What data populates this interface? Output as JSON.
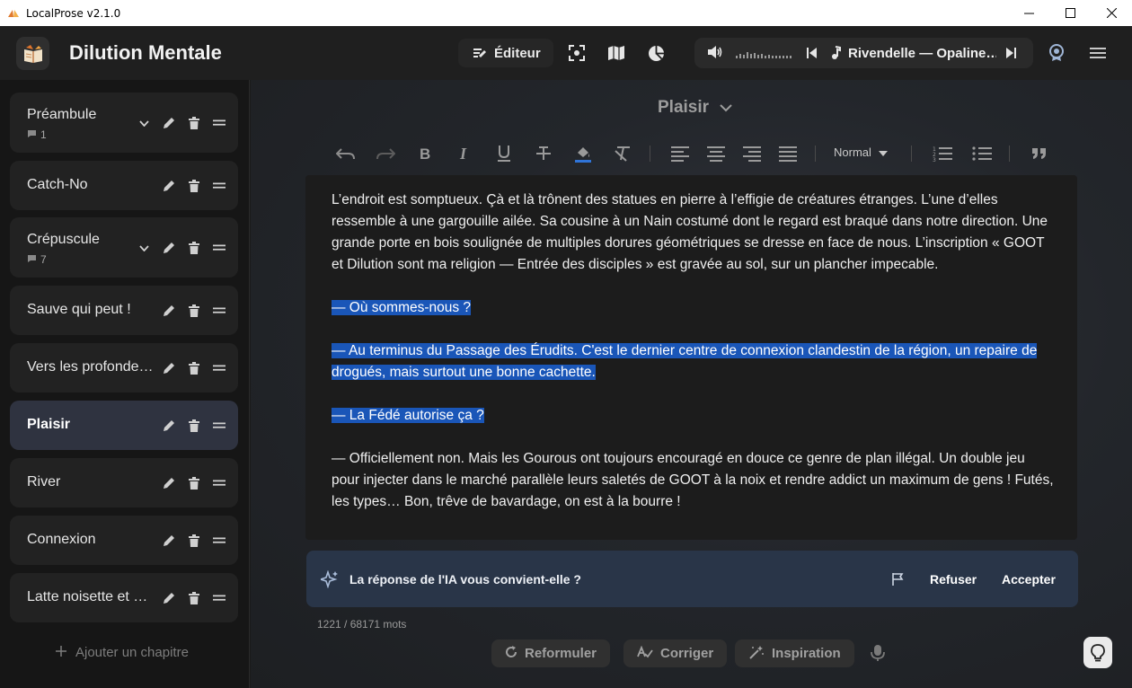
{
  "window": {
    "title": "LocalProse v2.1.0"
  },
  "header": {
    "doc_title": "Dilution Mentale",
    "editor_label": "Éditeur",
    "track": "Rivendelle — Opaline…"
  },
  "chapters": [
    {
      "title": "Préambule",
      "comments": "1",
      "expandable": true
    },
    {
      "title": "Catch-No"
    },
    {
      "title": "Crépuscule",
      "comments": "7",
      "expandable": true
    },
    {
      "title": "Sauve qui peut !"
    },
    {
      "title": "Vers les profonde…"
    },
    {
      "title": "Plaisir",
      "active": true
    },
    {
      "title": "River"
    },
    {
      "title": "Connexion"
    },
    {
      "title": "Latte noisette et …"
    }
  ],
  "sidebar": {
    "add_label": "Ajouter un chapitre"
  },
  "editor": {
    "chapter_selected": "Plaisir",
    "style_value": "Normal",
    "paragraphs": [
      "L’endroit est somptueux. Çà et là trônent des statues en pierre à l’effigie de créatures étranges. L’une d’elles ressemble à une gargouille ailée. Sa cousine à un Nain costumé dont le regard est braqué dans notre direction. Une grande porte en bois soulignée de multiples dorures géométriques se dresse en face de nous. L’inscription « GOOT et Dilution sont ma religion — Entrée des disciples » est gravée au sol, sur un plancher impecable.",
      "— Où sommes-nous ?",
      "— Au terminus du Passage des Érudits. C'est le dernier centre de connexion clandestin de la région, un repaire de drogués, mais surtout une bonne cachette.",
      "— La Fédé autorise ça ?",
      "— Officiellement non. Mais les Gourous ont toujours encouragé en douce ce genre de plan illégal. Un double jeu pour injecter dans le marché parallèle leurs saletés de GOOT à la noix et rendre addict un maximum de gens ! Futés, les types… Bon, trêve de bavardage, on est à la bourre !"
    ]
  },
  "ai_bar": {
    "question": "La réponse de l'IA vous convient-elle ?",
    "reject": "Refuser",
    "accept": "Accepter"
  },
  "word_count": "1221 / 68171 mots",
  "actions": {
    "rephrase": "Reformuler",
    "correct": "Corriger",
    "inspire": "Inspiration"
  },
  "colors": {
    "selection": "#1a56b8",
    "ai_bar": "#293548",
    "active_chapter": "#2f3340"
  }
}
